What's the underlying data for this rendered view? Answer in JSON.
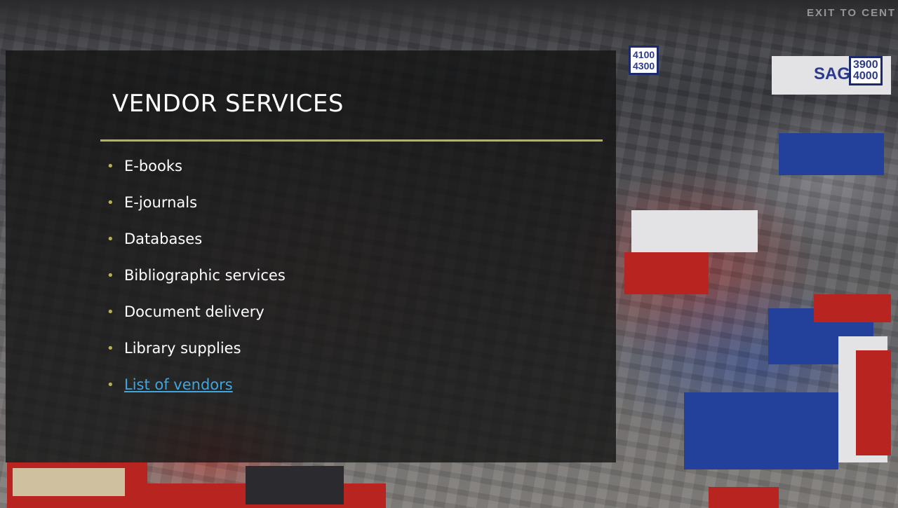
{
  "slide": {
    "title": "VENDOR SERVICES",
    "accent_color": "#b7b257",
    "link_color": "#3fa6e0",
    "bullets": [
      "E-books",
      "E-journals",
      "Databases",
      "Bibliographic services",
      "Document delivery",
      "Library supplies"
    ],
    "link": "List of vendors"
  },
  "background": {
    "signs": [
      [
        "4100",
        "4300"
      ],
      [
        "3900",
        "4000"
      ]
    ],
    "banner_text": "SAGE",
    "exit_text": "EXIT TO CENT"
  }
}
